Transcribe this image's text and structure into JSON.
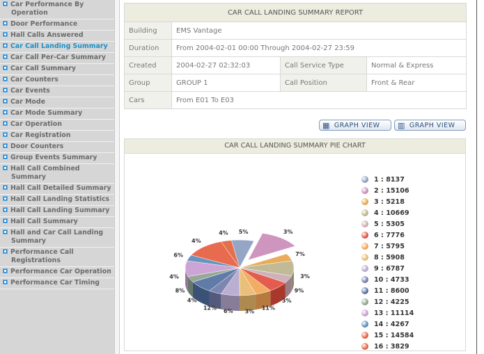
{
  "sidebar": {
    "items": [
      {
        "label": "Car Performance By Operation",
        "active": false
      },
      {
        "label": "Door Performance",
        "active": false
      },
      {
        "label": "Hall Calls Answered",
        "active": false
      },
      {
        "label": "Car Call Landing Summary",
        "active": true
      },
      {
        "label": "Car Call Per-Car Summary",
        "active": false
      },
      {
        "label": "Car Call Summary",
        "active": false
      },
      {
        "label": "Car Counters",
        "active": false
      },
      {
        "label": "Car Events",
        "active": false
      },
      {
        "label": "Car Mode",
        "active": false
      },
      {
        "label": "Car Mode Summary",
        "active": false
      },
      {
        "label": "Car Operation",
        "active": false
      },
      {
        "label": "Car Registration",
        "active": false
      },
      {
        "label": "Door Counters",
        "active": false
      },
      {
        "label": "Group Events Summary",
        "active": false
      },
      {
        "label": "Hall Call Combined Summary",
        "active": false
      },
      {
        "label": "Hall Call Detailed Summary",
        "active": false
      },
      {
        "label": "Hall Call Landing Statistics",
        "active": false
      },
      {
        "label": "Hall Call Landing Summary",
        "active": false
      },
      {
        "label": "Hall Call Summary",
        "active": false
      },
      {
        "label": "Hall and Car Call Landing Summary",
        "active": false
      },
      {
        "label": "Performance Call Registrations",
        "active": false
      },
      {
        "label": "Performance Car Operation",
        "active": false
      },
      {
        "label": "Performance Car Timing",
        "active": false
      }
    ],
    "bullet_color": "#1a7fcf",
    "active_color": "#1b8fc4"
  },
  "report": {
    "title": "CAR CALL LANDING SUMMARY REPORT",
    "building_label": "Building",
    "building_value": "EMS Vantage",
    "duration_label": "Duration",
    "duration_value": "From 2004-02-01  00:00 Through 2004-02-27  23:59",
    "created_label": "Created",
    "created_value": "2004-02-27 02:32:03",
    "call_service_type_label": "Call Service Type",
    "call_service_type_value": "Normal & Express",
    "group_label": "Group",
    "group_value": "GROUP 1",
    "call_position_label": "Call Position",
    "call_position_value": "Front & Rear",
    "cars_label": "Cars",
    "cars_value": "From E01 To E03"
  },
  "buttons": {
    "graph_view_1": "GRAPH VIEW",
    "graph_view_2": "GRAPH VIEW",
    "icons": [
      "table-grid-icon",
      "bar-chart-icon"
    ]
  },
  "chart_data": {
    "type": "pie",
    "title": "CAR CALL LANDING SUMMARY PIE CHART",
    "categories": [
      "1",
      "2",
      "3",
      "4",
      "5",
      "6",
      "7",
      "8",
      "9",
      "10",
      "11",
      "12",
      "13",
      "14",
      "15",
      "16"
    ],
    "values": [
      8137,
      15106,
      5218,
      10669,
      5305,
      7776,
      5795,
      5908,
      6787,
      4733,
      8600,
      4225,
      11114,
      4267,
      14584,
      3829
    ],
    "legend_labels": [
      "1 : 8137",
      "2 : 15106",
      "3 : 5218",
      "4 : 10669",
      "5 : 5305",
      "6 : 7776",
      "7 : 5795",
      "8 : 5908",
      "9 : 6787",
      "10 : 4733",
      "11 : 8600",
      "12 : 4225",
      "13 : 11114",
      "14 : 4267",
      "15 : 14584",
      "16 : 3829"
    ],
    "colors": [
      "#8a9bbf",
      "#c98ab8",
      "#e8a24a",
      "#b9b389",
      "#c9a8b4",
      "#e04a3a",
      "#f2a352",
      "#e8b86a",
      "#b4a6cc",
      "#6f78a8",
      "#4f6d9f",
      "#8aa08a",
      "#c79ad0",
      "#5a88b8",
      "#e55a3c",
      "#e0603a"
    ],
    "slice_labels": [
      "5%",
      "3%",
      "7%",
      "3%",
      "9%",
      "3%",
      "11%",
      "3%",
      "6%",
      "12%",
      "4%",
      "8%",
      "4%",
      "6%",
      "4%",
      "4%"
    ],
    "legend_position": "right",
    "exploded_slice": "2"
  }
}
